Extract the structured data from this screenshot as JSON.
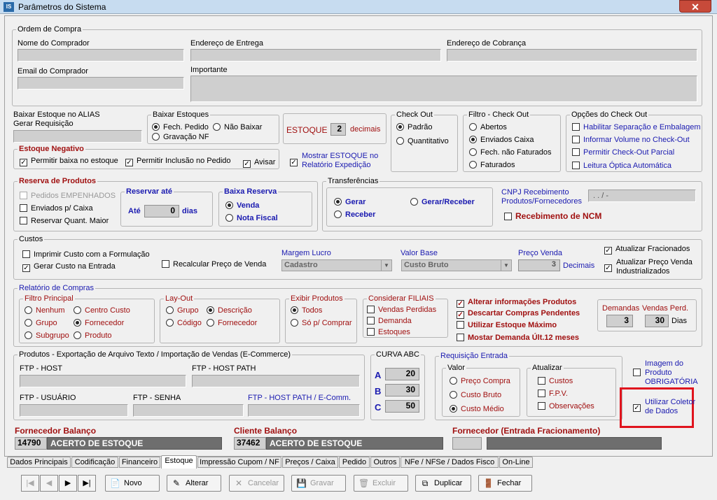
{
  "window": {
    "title": "Parâmetros do Sistema",
    "icon_text": "IS",
    "close": "✕"
  },
  "ordem": {
    "legend": "Ordem de Compra",
    "nome": "Nome do Comprador",
    "endereco_entrega": "Endereço de Entrega",
    "endereco_cobranca": "Endereço de Cobrança",
    "email": "Email do Comprador",
    "importante": "Importante"
  },
  "baixar_alias": {
    "line1": "Baixar Estoque no ALIAS",
    "line2": "Gerar Requisição"
  },
  "baixar_estoques": {
    "legend": "Baixar Estoques",
    "opt1": "Fech. Pedido",
    "opt2": "Não Baixar",
    "opt3": "Gravação NF"
  },
  "estoque_dec": {
    "label": "ESTOQUE",
    "value": "2",
    "suffix": "decimais"
  },
  "check_out": {
    "legend": "Check Out",
    "opt1": "Padrão",
    "opt2": "Quantitativo"
  },
  "filtro_checkout": {
    "legend": "Filtro - Check Out",
    "opt1": "Abertos",
    "opt2": "Enviados Caixa",
    "opt3": "Fech. não Faturados",
    "opt4": "Faturados"
  },
  "opcoes_checkout": {
    "legend": "Opções do Check Out",
    "opt1": "Habilitar Separação e Embalagem",
    "opt2": "Informar Volume no Check-Out",
    "opt3": "Permitir Check-Out Parcial",
    "opt4": "Leitura Óptica Automática"
  },
  "estoque_negativo": {
    "legend": "Estoque Negativo",
    "opt1": "Permitir baixa no estoque",
    "opt2": "Permitir Inclusão no Pedido",
    "opt3": "Avisar"
  },
  "mostrar_estoque": {
    "line1": "Mostrar ESTOQUE no",
    "line2": "Relatório Expedição"
  },
  "reserva": {
    "legend": "Reserva de Produtos",
    "opt1": "Pedidos EMPENHADOS",
    "opt2": "Enviados p/ Caixa",
    "opt3": "Reservar Quant. Maior"
  },
  "reservar_ate": {
    "legend": "Reservar até",
    "ate": "Até",
    "value": "0",
    "dias": "dias"
  },
  "baixa_reserva": {
    "legend": "Baixa Reserva",
    "opt1": "Venda",
    "opt2": "Nota Fiscal"
  },
  "transferencias": {
    "legend": "Transferências",
    "opt1": "Gerar",
    "opt2": "Gerar/Receber",
    "opt3": "Receber",
    "cnpj_line1": "CNPJ Recebimento",
    "cnpj_line2": "Produtos/Fornecedores",
    "cnpj_value": ". . /  -",
    "ncm": "Recebimento de NCM"
  },
  "custos": {
    "legend": "Custos",
    "opt1": "Imprimir Custo com a Formulação",
    "opt2": "Gerar Custo na Entrada",
    "opt3": "Recalcular Preço de Venda",
    "margem_label": "Margem Lucro",
    "margem_value": "Cadastro",
    "valor_base_label": "Valor Base",
    "valor_base_value": "Custo Bruto",
    "preco_label": "Preço Venda",
    "preco_value": "3",
    "decimais": "Decimais",
    "atualizar1": "Atualizar Fracionados",
    "atualizar2_line1": "Atualizar Preço Venda",
    "atualizar2_line2": "Industrializados"
  },
  "relatorio": {
    "legend": "Relatório de Compras",
    "filtro_legend": "Filtro Principal",
    "f1": "Nenhum",
    "f2": "Centro Custo",
    "f3": "Grupo",
    "f4": "Fornecedor",
    "f5": "Subgrupo",
    "f6": "Produto",
    "layout_legend": "Lay-Out",
    "l1": "Grupo",
    "l2": "Descrição",
    "l3": "Código",
    "l4": "Fornecedor",
    "exibir_legend": "Exibir Produtos",
    "e1": "Todos",
    "e2": "Só p/ Comprar",
    "filiais_legend": "Considerar FILIAIS",
    "c1": "Vendas Perdidas",
    "c2": "Demanda",
    "c3": "Estoques",
    "o1": "Alterar informações Produtos",
    "o2": "Descartar Compras Pendentes",
    "o3": "Utilizar Estoque Máximo",
    "o4": "Mostar Demanda Últ.12 meses",
    "demandas_label": "Demandas",
    "demandas_value": "3",
    "vendas_perd_label": "Vendas Perd.",
    "vendas_perd_value": "30",
    "dias": "Dias"
  },
  "produtos_export": {
    "legend": "Produtos - Exportação de Arquivo Texto / Importação de Vendas (E-Commerce)",
    "ftp_host": "FTP - HOST",
    "ftp_host_path": "FTP - HOST PATH",
    "ftp_usuario": "FTP - USUÁRIO",
    "ftp_senha": "FTP - SENHA",
    "ftp_path_ecomm": "FTP - HOST PATH / E-Comm."
  },
  "curva": {
    "legend": "CURVA ABC",
    "a": "A",
    "a_val": "20",
    "b": "B",
    "b_val": "30",
    "c": "C",
    "c_val": "50"
  },
  "requisicao": {
    "legend": "Requisição Entrada",
    "valor_legend": "Valor",
    "v1": "Preço Compra",
    "v2": "Custo Bruto",
    "v3": "Custo Médio",
    "atualizar_legend": "Atualizar",
    "a1": "Custos",
    "a2": "F.P.V.",
    "a3": "Observações"
  },
  "imagem": {
    "line1": "Imagem do",
    "line2": "Produto",
    "line3": "OBRIGATÓRIA"
  },
  "coletor": {
    "line1": "Utilizar Coletor",
    "line2": "de Dados"
  },
  "fornecedor_balanco": {
    "label": "Fornecedor Balanço",
    "code": "14790",
    "name": "ACERTO DE ESTOQUE"
  },
  "cliente_balanco": {
    "label": "Cliente Balanço",
    "code": "37462",
    "name": "ACERTO DE ESTOQUE"
  },
  "fornecedor_entrada": {
    "label": "Fornecedor (Entrada Fracionamento)"
  },
  "tabs": [
    "Dados Principais",
    "Codificação",
    "Financeiro",
    "Estoque",
    "Impressão Cupom / NF",
    "Preços / Caixa",
    "Pedido",
    "Outros",
    "NFe / NFSe / Dados Fisco",
    "On-Line"
  ],
  "toolbar": {
    "first": "|◀",
    "prev": "◀",
    "next": "▶",
    "last": "▶|",
    "novo": "Novo",
    "alterar": "Alterar",
    "cancelar": "Cancelar",
    "gravar": "Gravar",
    "excluir": "Excluir",
    "duplicar": "Duplicar",
    "fechar": "Fechar"
  }
}
